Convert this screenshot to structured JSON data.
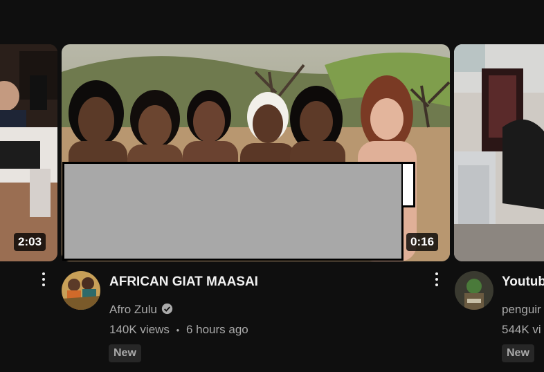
{
  "cards": [
    {
      "duration": "2:03"
    },
    {
      "title": "AFRICAN GIAT MAASAI",
      "channel": "Afro Zulu",
      "views": "140K views",
      "separator": "•",
      "age": "6 hours ago",
      "badge": "New",
      "duration": "0:16",
      "verified_icon": "verified-check-icon"
    },
    {
      "title": "Youtub",
      "channel": "penguir",
      "views": "544K vi",
      "badge": "New"
    }
  ],
  "colors": {
    "background": "#0f0f0f",
    "title_text": "#f1f1f1",
    "meta_text": "#aaaaaa",
    "badge_bg": "#272727",
    "censor_box": "#a8a8a8"
  }
}
